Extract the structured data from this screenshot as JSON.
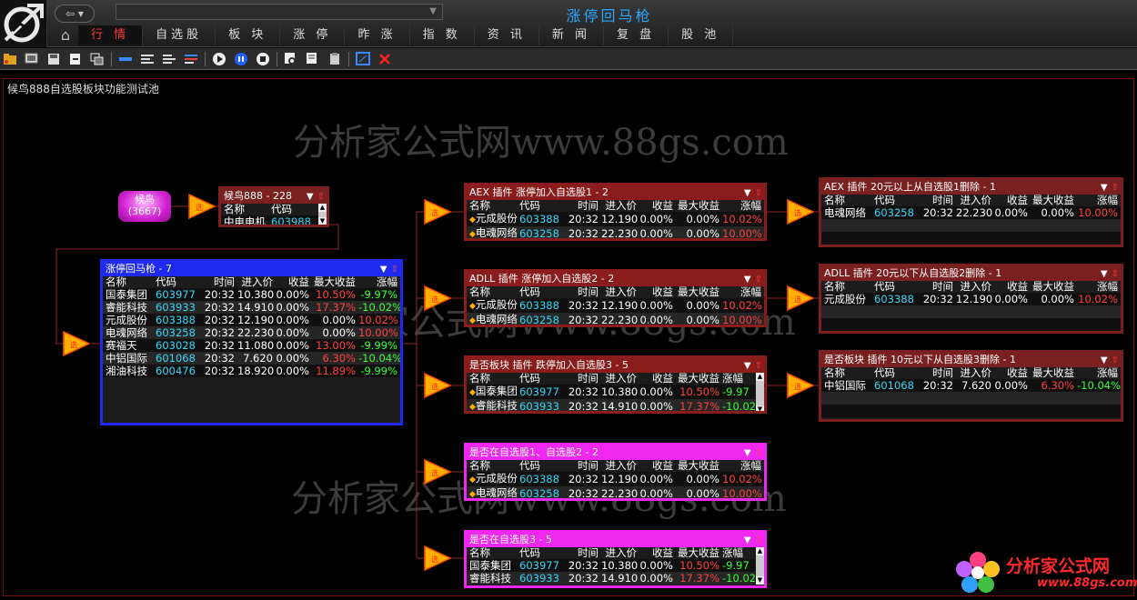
{
  "app": {
    "title": "涨停回马枪",
    "nav_button": "⇦ ▾",
    "address": "",
    "tabs": [
      "行 情",
      "自选股",
      "板 块",
      "涨 停",
      "昨 涨",
      "指 数",
      "资 讯",
      "新 闻",
      "复 盘",
      "股 池"
    ],
    "active_tab": "行 情"
  },
  "toolbar_icons": [
    "open-folder-icon",
    "screen-icon",
    "save-icon",
    "export-icon",
    "copy-windows-icon",
    "layout-1-icon",
    "layout-2-icon",
    "layout-3-icon",
    "layout-4-icon",
    "play-icon",
    "pause-icon",
    "stop-icon",
    "zoom-icon",
    "find-icon",
    "clipboard-icon",
    "window-icon",
    "close-red-icon"
  ],
  "pool_title": "候鸟888自选股板块功能测试池",
  "watermark": "分析家公式网www.88gs.com",
  "source_node": {
    "line1": "候鸟",
    "line2": "(3667)"
  },
  "columns": {
    "name": "名称",
    "code": "代码",
    "time": "时间",
    "price": "进入价",
    "ret": "收益",
    "max": "最大收益",
    "chg": "涨幅"
  },
  "panels": {
    "hn": {
      "title": "候鸟888 - 228",
      "rows": [
        {
          "name": "中电电机",
          "code": "603988"
        }
      ]
    },
    "main": {
      "title": "涨停回马枪 - 7",
      "rows": [
        {
          "name": "国泰集团",
          "code": "603977",
          "time": "20:32",
          "price": "10.380",
          "ret": "0.00%",
          "max": "10.50%",
          "chg": "-9.97%"
        },
        {
          "name": "睿能科技",
          "code": "603933",
          "time": "20:32",
          "price": "14.910",
          "ret": "0.00%",
          "max": "17.37%",
          "chg": "-10.02%"
        },
        {
          "name": "元成股份",
          "code": "603388",
          "time": "20:32",
          "price": "12.190",
          "ret": "0.00%",
          "max": "0.00%",
          "chg": "10.02%"
        },
        {
          "name": "电魂网络",
          "code": "603258",
          "time": "20:32",
          "price": "22.230",
          "ret": "0.00%",
          "max": "0.00%",
          "chg": "10.00%"
        },
        {
          "name": "赛福天",
          "code": "603028",
          "time": "20:32",
          "price": "11.080",
          "ret": "0.00%",
          "max": "13.00%",
          "chg": "-9.99%"
        },
        {
          "name": "中铝国际",
          "code": "601068",
          "time": "20:32",
          "price": "7.620",
          "ret": "0.00%",
          "max": "6.30%",
          "chg": "-10.04%"
        },
        {
          "name": "湘油科技",
          "code": "600476",
          "time": "20:32",
          "price": "18.920",
          "ret": "0.00%",
          "max": "11.89%",
          "chg": "-9.99%"
        }
      ]
    },
    "aex1": {
      "title": "AEX 插件 涨停加入自选股1 - 2",
      "rows": [
        {
          "name": "元成股份",
          "code": "603388",
          "time": "20:32",
          "price": "12.190",
          "ret": "0.00%",
          "max": "0.00%",
          "chg": "10.02%"
        },
        {
          "name": "电魂网络",
          "code": "603258",
          "time": "20:32",
          "price": "22.230",
          "ret": "0.00%",
          "max": "0.00%",
          "chg": "10.00%"
        }
      ]
    },
    "adll2": {
      "title": "ADLL 插件 涨停加入自选股2 - 2",
      "rows": [
        {
          "name": "元成股份",
          "code": "603388",
          "time": "20:32",
          "price": "12.190",
          "ret": "0.00%",
          "max": "0.00%",
          "chg": "10.02%"
        },
        {
          "name": "电魂网络",
          "code": "603258",
          "time": "20:32",
          "price": "22.230",
          "ret": "0.00%",
          "max": "0.00%",
          "chg": "10.00%"
        }
      ]
    },
    "sb3": {
      "title": "是否板块 插件 跌停加入自选股3 - 5",
      "rows": [
        {
          "name": "国泰集团",
          "code": "603977",
          "time": "20:32",
          "price": "10.380",
          "ret": "0.00%",
          "max": "10.50%",
          "chg": "-9.97"
        },
        {
          "name": "睿能科技",
          "code": "603933",
          "time": "20:32",
          "price": "14.910",
          "ret": "0.00%",
          "max": "17.37%",
          "chg": "-10.02"
        }
      ]
    },
    "zx12": {
      "title": "是否在自选股1、自选股2 - 2",
      "rows": [
        {
          "name": "元成股份",
          "code": "603388",
          "time": "20:32",
          "price": "12.190",
          "ret": "0.00%",
          "max": "0.00%",
          "chg": "10.02%"
        },
        {
          "name": "电魂网络",
          "code": "603258",
          "time": "20:32",
          "price": "22.230",
          "ret": "0.00%",
          "max": "0.00%",
          "chg": "10.00%"
        }
      ]
    },
    "zx3": {
      "title": "是否在自选股3 - 5",
      "rows": [
        {
          "name": "国泰集团",
          "code": "603977",
          "time": "20:32",
          "price": "10.380",
          "ret": "0.00%",
          "max": "10.50%",
          "chg": "-9.97"
        },
        {
          "name": "睿能科技",
          "code": "603933",
          "time": "20:32",
          "price": "14.910",
          "ret": "0.00%",
          "max": "17.37%",
          "chg": "-10.02"
        }
      ]
    },
    "aexdel": {
      "title": "AEX 插件 20元以上从自选股1删除 - 1",
      "rows": [
        {
          "name": "电魂网络",
          "code": "603258",
          "time": "20:32",
          "price": "22.230",
          "ret": "0.00%",
          "max": "0.00%",
          "chg": "10.00%"
        }
      ]
    },
    "adlldel": {
      "title": "ADLL 插件 20元以下从自选股2删除 - 1",
      "rows": [
        {
          "name": "元成股份",
          "code": "603388",
          "time": "20:32",
          "price": "12.190",
          "ret": "0.00%",
          "max": "0.00%",
          "chg": "10.02%"
        }
      ]
    },
    "sbdel": {
      "title": "是否板块 插件 10元以下从自选股3删除 - 1",
      "rows": [
        {
          "name": "中铝国际",
          "code": "601068",
          "time": "20:32",
          "price": "7.620",
          "ret": "0.00%",
          "max": "6.30%",
          "chg": "-10.04%"
        }
      ]
    }
  },
  "brand": {
    "name": "分析家公式网",
    "url": "www.88gs.com"
  },
  "colors": {
    "accent": "#2aa8ff",
    "up": "#ff4040",
    "down": "#35ff35",
    "code": "#35d7f5",
    "panel_red": "#7a2020",
    "panel_blue": "#1e2af0",
    "panel_magenta": "#ee28ee"
  }
}
